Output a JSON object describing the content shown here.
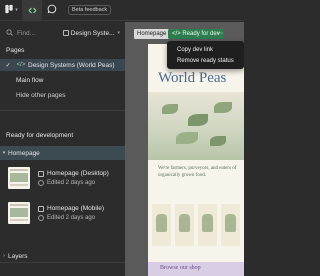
{
  "toolbar": {
    "logo_icon": "figma-logo-icon",
    "dev_mode_icon": "dev-mode-code-icon",
    "comment_icon": "comment-icon",
    "badge": "Beta feedback"
  },
  "search": {
    "placeholder": "Find...",
    "file_name": "Design Syste..."
  },
  "pages": {
    "heading": "Pages",
    "items": [
      {
        "label": "Design Systems (World Peas)",
        "selected": true
      },
      {
        "label": "Main flow",
        "selected": false
      },
      {
        "label": "Hide other pages",
        "selected": false
      }
    ]
  },
  "ready": {
    "heading": "Ready for development",
    "section": "Homepage",
    "frames": [
      {
        "name": "Homepage (Desktop)",
        "meta": "Edited 2 days ago"
      },
      {
        "name": "Homepage (Mobile)",
        "meta": "Edited 2 days ago"
      }
    ]
  },
  "layers": {
    "heading": "Layers"
  },
  "canvas": {
    "frame_tag": "Homepage",
    "status_tag": "Ready for dev",
    "status_color": "#2e7d4f",
    "context_menu": [
      "Copy dev link",
      "Remove ready status"
    ],
    "site_title": "World Peas",
    "site_quote": "We're farmers, purveyors, and eaters of organically grown food.",
    "site_footer": "Browse our shop"
  }
}
